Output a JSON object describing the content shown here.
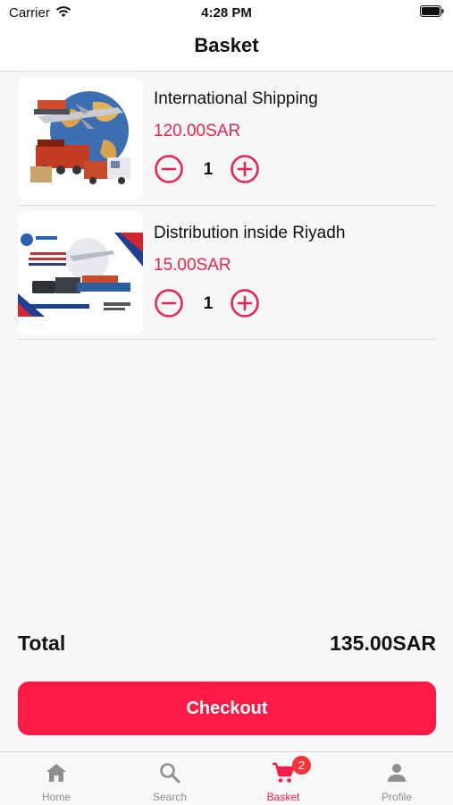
{
  "status_bar": {
    "carrier": "Carrier",
    "time": "4:28 PM"
  },
  "header": {
    "title": "Basket"
  },
  "basket": {
    "items": [
      {
        "title": "International Shipping",
        "price": "120.00SAR",
        "quantity": "1",
        "image": "shipping-collage-image"
      },
      {
        "title": "Distribution inside Riyadh",
        "price": "15.00SAR",
        "quantity": "1",
        "image": "riyadh-distribution-flyer-image"
      }
    ]
  },
  "summary": {
    "total_label": "Total",
    "total_value": "135.00SAR"
  },
  "checkout": {
    "label": "Checkout"
  },
  "tabs": [
    {
      "label": "Home",
      "icon": "home-icon",
      "active": false
    },
    {
      "label": "Search",
      "icon": "search-icon",
      "active": false
    },
    {
      "label": "Basket",
      "icon": "cart-icon",
      "active": true,
      "badge": "2"
    },
    {
      "label": "Profile",
      "icon": "user-icon",
      "active": false
    }
  ],
  "colors": {
    "accent": "#fc1a46",
    "price": "#e8254f",
    "inactive_tab": "#8e8e8e",
    "badge": "#f0343a"
  }
}
